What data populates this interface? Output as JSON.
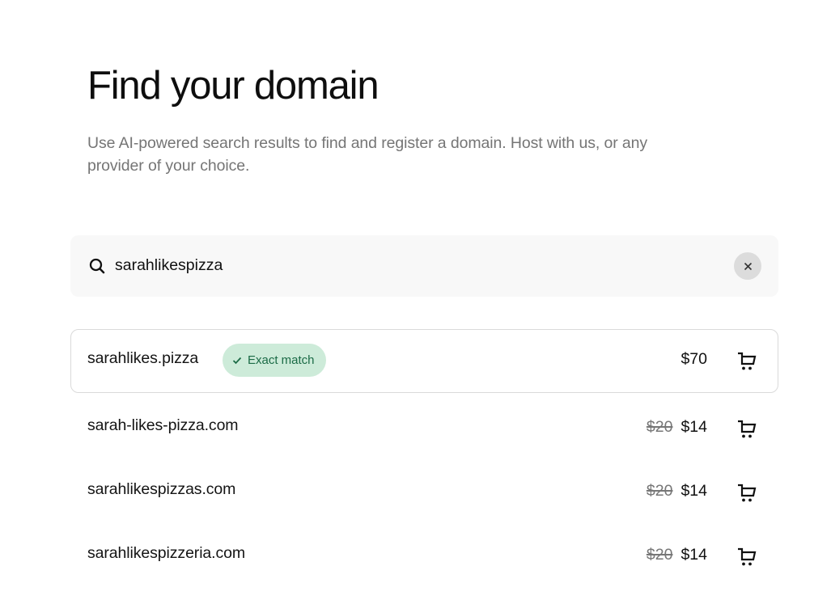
{
  "header": {
    "title": "Find your domain",
    "subtitle": "Use AI-powered search results to find and register a domain. Host with us, or any provider of your choice."
  },
  "search": {
    "value": "sarahlikespizza",
    "icon": "search-icon",
    "clear_icon": "close-icon"
  },
  "results": [
    {
      "domain": "sarahlikes.pizza",
      "badge": "Exact match",
      "badge_icon": "check-icon",
      "original_price": "",
      "price": "$70",
      "action_icon": "cart-icon"
    },
    {
      "domain": "sarah-likes-pizza.com",
      "badge": "",
      "original_price": "$20",
      "price": "$14",
      "action_icon": "cart-icon"
    },
    {
      "domain": "sarahlikespizzas.com",
      "badge": "",
      "original_price": "$20",
      "price": "$14",
      "action_icon": "cart-icon"
    },
    {
      "domain": "sarahlikespizzeria.com",
      "badge": "",
      "original_price": "$20",
      "price": "$14",
      "action_icon": "cart-icon"
    }
  ],
  "colors": {
    "badge_bg": "#cdebd9",
    "badge_text": "#1b6b46",
    "search_bg": "#f8f8f8",
    "subtitle": "#757575"
  }
}
